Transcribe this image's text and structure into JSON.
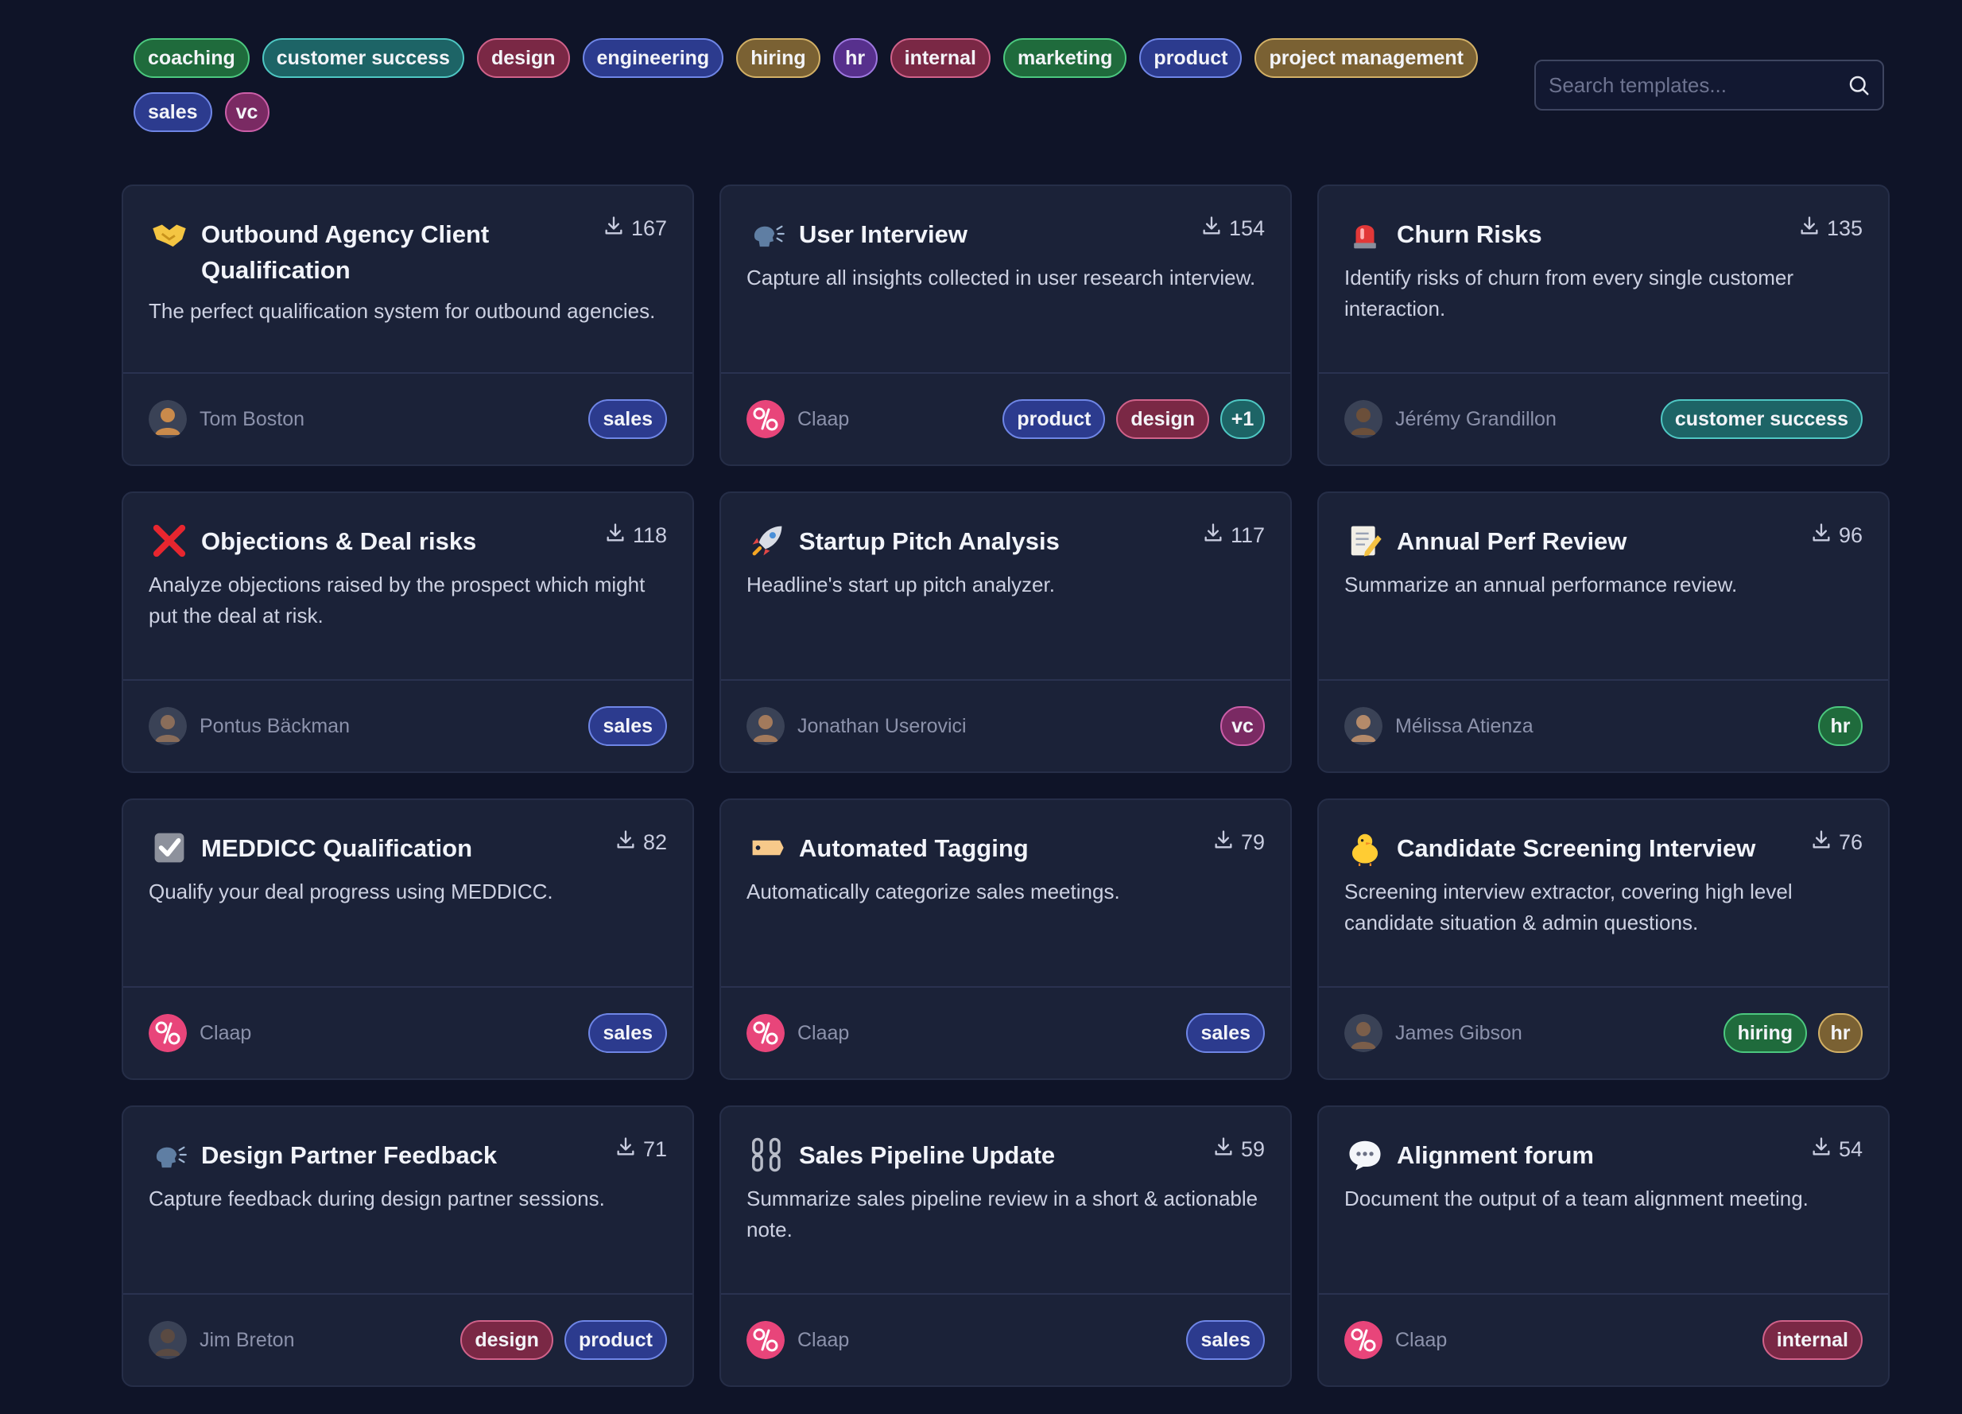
{
  "filters": [
    {
      "label": "coaching",
      "color": "green"
    },
    {
      "label": "customer success",
      "color": "teal"
    },
    {
      "label": "design",
      "color": "rose"
    },
    {
      "label": "engineering",
      "color": "blue"
    },
    {
      "label": "hiring",
      "color": "gold"
    },
    {
      "label": "hr",
      "color": "purple"
    },
    {
      "label": "internal",
      "color": "rose"
    },
    {
      "label": "marketing",
      "color": "green"
    },
    {
      "label": "product",
      "color": "blue"
    },
    {
      "label": "project management",
      "color": "gold"
    },
    {
      "label": "sales",
      "color": "blue"
    },
    {
      "label": "vc",
      "color": "magenta"
    }
  ],
  "search": {
    "placeholder": "Search templates...",
    "value": ""
  },
  "cards": [
    {
      "icon": "handshake-icon",
      "title": "Outbound Agency Client Qualification",
      "downloads": "167",
      "description": "The perfect qualification system for outbound agencies.",
      "author": "Tom Boston",
      "avatar": "photo",
      "tags": [
        {
          "label": "sales",
          "color": "blue"
        }
      ]
    },
    {
      "icon": "speaking-head-icon",
      "title": "User Interview",
      "downloads": "154",
      "description": "Capture all insights collected in user research interview.",
      "author": "Claap",
      "avatar": "claap",
      "tags": [
        {
          "label": "product",
          "color": "blue"
        },
        {
          "label": "design",
          "color": "rose"
        },
        {
          "label": "+1",
          "color": "teal"
        }
      ]
    },
    {
      "icon": "siren-icon",
      "title": "Churn Risks",
      "downloads": "135",
      "description": "Identify risks of churn from every single customer interaction.",
      "author": "Jérémy Grandillon",
      "avatar": "photo",
      "tags": [
        {
          "label": "customer success",
          "color": "teal"
        }
      ]
    },
    {
      "icon": "cross-mark-icon",
      "title": "Objections & Deal risks",
      "downloads": "118",
      "description": "Analyze objections raised by the prospect which might put the deal at risk.",
      "author": "Pontus Bäckman",
      "avatar": "photo",
      "tags": [
        {
          "label": "sales",
          "color": "blue"
        }
      ]
    },
    {
      "icon": "rocket-icon",
      "title": "Startup Pitch Analysis",
      "downloads": "117",
      "description": "Headline's start up pitch analyzer.",
      "author": "Jonathan Userovici",
      "avatar": "photo",
      "tags": [
        {
          "label": "vc",
          "color": "magenta"
        }
      ]
    },
    {
      "icon": "memo-icon",
      "title": "Annual Perf Review",
      "downloads": "96",
      "description": "Summarize an annual performance review.",
      "author": "Mélissa Atienza",
      "avatar": "photo",
      "tags": [
        {
          "label": "hr",
          "color": "green"
        }
      ]
    },
    {
      "icon": "check-box-icon",
      "title": "MEDDICC Qualification",
      "downloads": "82",
      "description": "Qualify your deal progress using MEDDICC.",
      "author": "Claap",
      "avatar": "claap",
      "tags": [
        {
          "label": "sales",
          "color": "blue"
        }
      ]
    },
    {
      "icon": "label-tag-icon",
      "title": "Automated Tagging",
      "downloads": "79",
      "description": "Automatically categorize sales meetings.",
      "author": "Claap",
      "avatar": "claap",
      "tags": [
        {
          "label": "sales",
          "color": "blue"
        }
      ]
    },
    {
      "icon": "chick-icon",
      "title": "Candidate Screening Interview",
      "downloads": "76",
      "description": "Screening interview extractor, covering high level candidate situation & admin questions.",
      "author": "James Gibson",
      "avatar": "photo",
      "tags": [
        {
          "label": "hiring",
          "color": "green"
        },
        {
          "label": "hr",
          "color": "gold"
        }
      ]
    },
    {
      "icon": "speaking-head-icon",
      "title": "Design Partner Feedback",
      "downloads": "71",
      "description": "Capture feedback during design partner sessions.",
      "author": "Jim Breton",
      "avatar": "photo",
      "tags": [
        {
          "label": "design",
          "color": "rose"
        },
        {
          "label": "product",
          "color": "blue"
        }
      ]
    },
    {
      "icon": "chains-icon",
      "title": "Sales Pipeline Update",
      "downloads": "59",
      "description": "Summarize sales pipeline review in a short & actionable note.",
      "author": "Claap",
      "avatar": "claap",
      "tags": [
        {
          "label": "sales",
          "color": "blue"
        }
      ]
    },
    {
      "icon": "speech-bubble-icon",
      "title": "Alignment forum",
      "downloads": "54",
      "description": "Document the output of a team alignment meeting.",
      "author": "Claap",
      "avatar": "claap",
      "tags": [
        {
          "label": "internal",
          "color": "rose"
        }
      ]
    }
  ],
  "colors": {
    "background": "#0f1428",
    "card": "#1b2238",
    "claap_brand": "#e8457a"
  }
}
